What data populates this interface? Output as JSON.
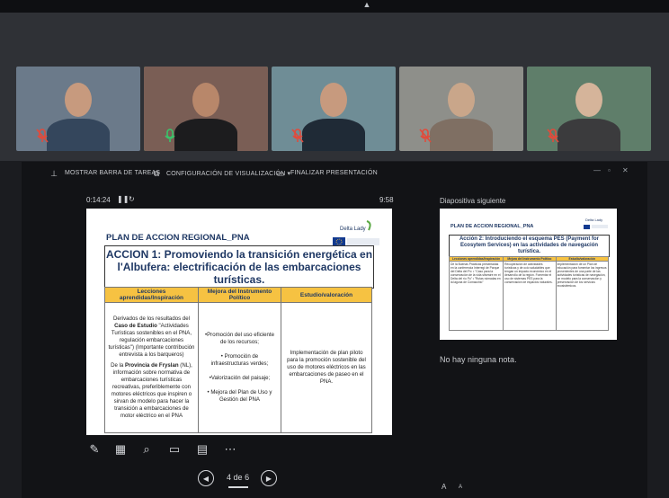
{
  "window": {
    "collapse_icon": "chevron-up-icon"
  },
  "participants": [
    {
      "name": "participant-1",
      "mic": "muted",
      "bg": "#6b7a8a",
      "shirt": "#34465c",
      "skin": "#c79a7e",
      "speaking": false
    },
    {
      "name": "participant-2",
      "mic": "on",
      "bg": "#7a5e55",
      "shirt": "#1c1c1e",
      "skin": "#b8876a",
      "speaking": true
    },
    {
      "name": "participant-3",
      "mic": "muted",
      "bg": "#6f8d96",
      "shirt": "#1f2a36",
      "skin": "#c79a7e",
      "speaking": false
    },
    {
      "name": "participant-4",
      "mic": "muted",
      "bg": "#8e8f8a",
      "shirt": "#7f6f63",
      "skin": "#c9a68a",
      "speaking": false
    },
    {
      "name": "participant-5",
      "mic": "muted",
      "bg": "#5f7e6a",
      "shirt": "#3b3b3d",
      "skin": "#d5b49a",
      "speaking": false
    }
  ],
  "toolbar": {
    "taskbar": "MOSTRAR BARRA DE TAREAS",
    "display": "CONFIGURACIÓN DE VISUALIZACIÓN ▾",
    "end": "FINALIZAR PRESENTACIÓN"
  },
  "presentation": {
    "elapsed": "0:14:24",
    "clock": "9:58",
    "next_label": "Diapositiva siguiente",
    "notes": "No hay ninguna nota.",
    "page_current": "4",
    "page_sep": "de",
    "page_total": "6"
  },
  "slide": {
    "header": "PLAN DE ACCION REGIONAL_PNA",
    "logo": "Delta Lady",
    "action": "ACCION 1: Promoviendo la transición energética en l'Albufera: electrificación de las embarcaciones turísticas.",
    "columns": [
      "Lecciones aprendidas/Inspiración",
      "Mejora del Instrumento Político",
      "Estudio/valoración"
    ],
    "col1_p1_pre": "Derivados de los resultados del ",
    "col1_p1_bold": "Caso de Estudio",
    "col1_p1_post": " \"Actividades Turísticas sostenibles en el PNA, regulación embarcaciones turísticas\") (Importante contribución entrevista a los barqueros)",
    "col1_p2_pre": "De la ",
    "col1_p2_bold": "Provincia de Fryslan",
    "col1_p2_post": " (NL), información sobre normativa de embarcaciones turísticas recreativas, preferiblemente con motores eléctricos que inspiren o sirvan de modelo para hacer la transición a embarcaciones de motor eléctrico en el PNA",
    "col2": [
      "•Promoción del uso eficiente de los recursos;",
      "• Promoción de infraestructuras verdes;",
      "•Valorización del paisaje;",
      "• Mejora del Plan de Uso y Gestión del PNA"
    ],
    "col3": "Implementación de plan piloto para la promoción sostenible del uso de motores eléctricos en las embarcaciones de paseo en el PNA."
  },
  "next_slide": {
    "header": "PLAN DE ACCION REGIONAL_PNA",
    "logo": "Delta Lady",
    "action": "Acción 2: Introduciendo el esquema PES (Payment for Ecosytem Services) en las actividades de navegación turística.",
    "columns": [
      "Lecciones aprendidas/Inspiración",
      "Mejora del Instrumento Político",
      "Estudio/valoración"
    ],
    "c1": "De la Buenas Prácticas presentadas en la conferencia Interregi de Parque del Delta del Po: • \"Caso para la conservación de la vida silvestre en el Delta del río Po\" • \"Rutas nómadas en la laguna de Comacchio\"",
    "c2": "Recuperación de actividades turísticas y de ocio saludables que tengan un impacto económico en el desarrollo de la región. Fomentar el uso de sistemas PES para la conservación de espacios naturales.",
    "c3": "Implementación de un Plan de educación para fomentar los ingresos provenientes de una parte de las actividades turísticas de navegación, un modelo para la conservación y preservación de los servicios ecosistémicos."
  },
  "tools": [
    "pen-icon",
    "slides-grid-icon",
    "search-icon",
    "screen-icon",
    "subtitles-icon",
    "more-icon"
  ],
  "font_controls": [
    "A",
    "A"
  ]
}
